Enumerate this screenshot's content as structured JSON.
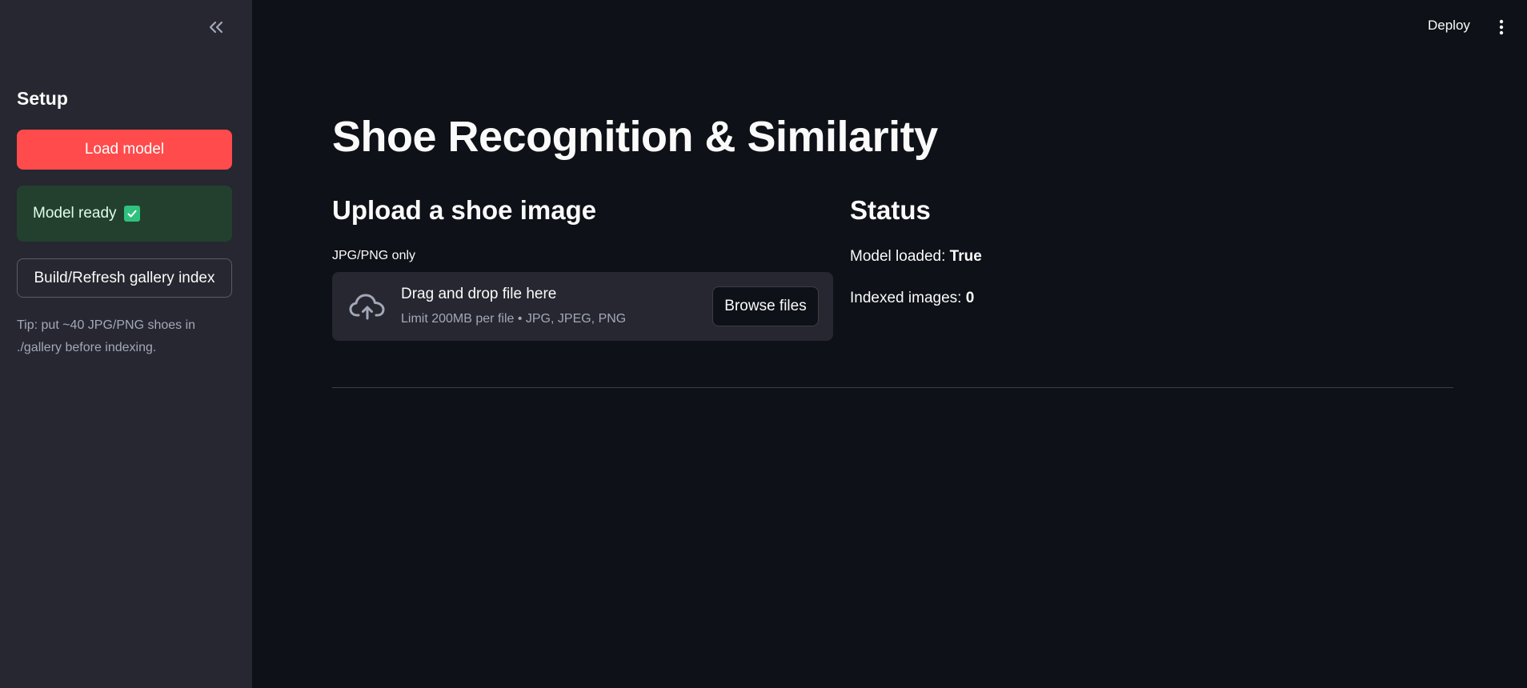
{
  "sidebar": {
    "heading": "Setup",
    "load_button": "Load model",
    "success_message": "Model ready",
    "build_button": "Build/Refresh gallery index",
    "tip": "Tip: put ~40 JPG/PNG shoes in ./gallery before indexing."
  },
  "header": {
    "deploy_label": "Deploy"
  },
  "main": {
    "title": "Shoe Recognition & Similarity",
    "upload": {
      "heading": "Upload a shoe image",
      "label": "JPG/PNG only",
      "drop_text": "Drag and drop file here",
      "limit_text": "Limit 200MB per file • JPG, JPEG, PNG",
      "browse_button": "Browse files"
    },
    "status": {
      "heading": "Status",
      "model_loaded_label": "Model loaded:",
      "model_loaded_value": "True",
      "indexed_images_label": "Indexed images:",
      "indexed_images_value": "0"
    }
  },
  "colors": {
    "background": "#0e1117",
    "sidebar": "#262730",
    "primary": "#ff4b4b",
    "success_bg": "#23402e",
    "success_check": "#2ec27e"
  },
  "icons": {
    "collapse": "double-chevron-left-icon",
    "menu": "kebab-menu-icon",
    "upload": "cloud-upload-icon",
    "check": "check-box-icon"
  }
}
